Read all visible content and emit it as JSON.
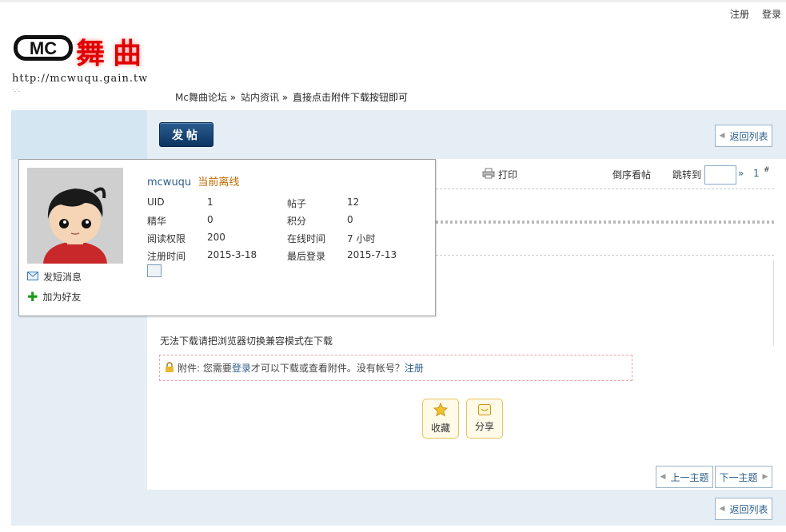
{
  "top_links": [
    "注册",
    "登录"
  ],
  "logo": {
    "mark": "MC",
    "cn": "舞曲",
    "url": "http://mcwuqu.gain.tw",
    "dots": "·.·."
  },
  "breadcrumb": [
    "Mc舞曲论坛",
    "站内资讯",
    "直接点击附件下载按钮即可"
  ],
  "breadcrumb_sep": "»",
  "post_button": "发帖",
  "back_list": "返回列表",
  "toolbar": {
    "print": "打印",
    "reverse": "倒序看帖",
    "jump": "跳转到",
    "jump_arrow": "»",
    "floor": "1",
    "floor_hash": "#"
  },
  "user": {
    "name": "mcwuqu",
    "status": "当前离线",
    "fields": [
      {
        "label": "UID",
        "value": "1"
      },
      {
        "label": "帖子",
        "value": "12"
      },
      {
        "label": "精华",
        "value": "0"
      },
      {
        "label": "积分",
        "value": "0"
      },
      {
        "label": "阅读权限",
        "value": "200"
      },
      {
        "label": "在线时间",
        "value": "7 小时"
      },
      {
        "label": "注册时间",
        "value": "2015-3-18"
      },
      {
        "label": "最后登录",
        "value": "2015-7-13"
      }
    ],
    "send_pm": "发短消息",
    "add_friend": "加为好友"
  },
  "post": {
    "message": "无法下载请把浏览器切换兼容模式在下载",
    "attach_prefix": "附件: 您需要",
    "attach_login": "登录",
    "attach_middle": "才可以下载或查看附件。没有帐号？",
    "attach_register": "注册"
  },
  "actions": {
    "favorite": "收藏",
    "share": "分享"
  },
  "nav": {
    "prev": "上一主题",
    "next": "下一主题"
  },
  "colors": {
    "link": "#2d5f8a",
    "band": "#e5eef5",
    "logo_red": "#e00000"
  }
}
